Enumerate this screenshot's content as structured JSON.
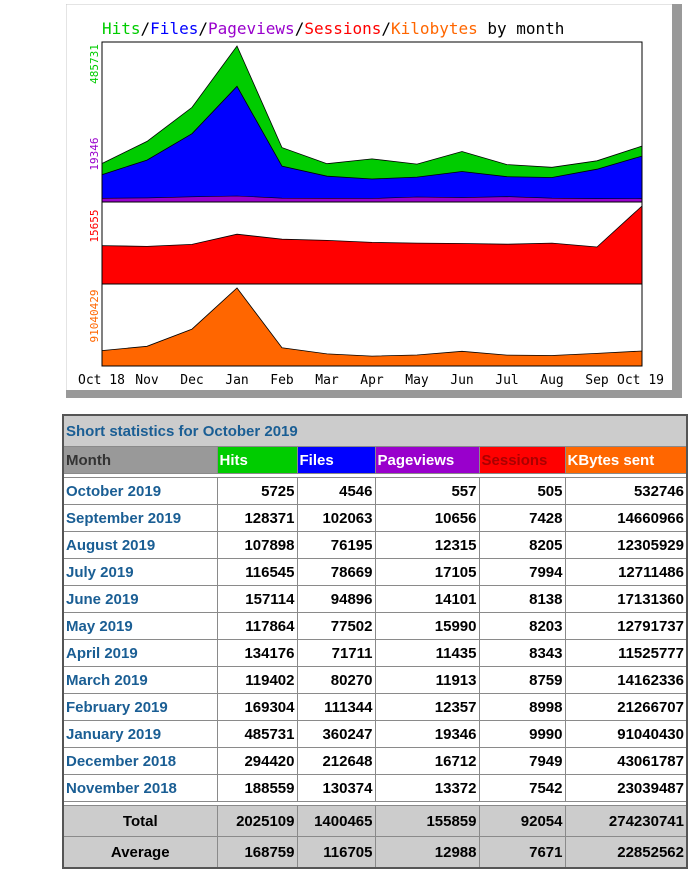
{
  "colors": {
    "hits": "#00cc00",
    "files": "#0000ff",
    "pageviews": "#9900cc",
    "sessions": "#ff0000",
    "kilobytes": "#ff6600",
    "label_blue": "#1a5e94"
  },
  "chart_data": {
    "type": "area",
    "title_parts": [
      {
        "text": "Hits",
        "key": "hits"
      },
      {
        "text": "/",
        "key": "sep"
      },
      {
        "text": "Files",
        "key": "files"
      },
      {
        "text": "/",
        "key": "sep"
      },
      {
        "text": "Pageviews",
        "key": "pageviews"
      },
      {
        "text": "/",
        "key": "sep"
      },
      {
        "text": "Sessions",
        "key": "sessions"
      },
      {
        "text": "/",
        "key": "sep"
      },
      {
        "text": "Kilobytes",
        "key": "kilobytes"
      },
      {
        "text": " by month",
        "key": "plain"
      }
    ],
    "x": [
      "Oct 18",
      "Nov",
      "Dec",
      "Jan",
      "Feb",
      "Mar",
      "Apr",
      "May",
      "Jun",
      "Jul",
      "Aug",
      "Sep",
      "Oct 19"
    ],
    "panels": [
      {
        "axis_label": "485731",
        "label_key": "hits",
        "series": [
          "hits",
          "files",
          "pageviews"
        ],
        "max": 485731
      },
      {
        "axis_label": "19346",
        "label_key": "pageviews",
        "series": [],
        "max": 19346
      },
      {
        "axis_label": "15655",
        "label_key": "sessions",
        "series": [
          "sessions"
        ],
        "max": 15655
      },
      {
        "axis_label": "91040429",
        "label_key": "kilobytes",
        "series": [
          "kilobytes"
        ],
        "max": 91040430
      }
    ],
    "series": [
      {
        "key": "hits",
        "values": [
          120000,
          188559,
          294420,
          485731,
          169304,
          119402,
          134176,
          117864,
          157114,
          116545,
          107898,
          128371,
          174000
        ]
      },
      {
        "key": "files",
        "values": [
          85000,
          130374,
          212648,
          360247,
          111344,
          80270,
          71711,
          77502,
          94896,
          78669,
          76195,
          102063,
          143000
        ]
      },
      {
        "key": "pageviews",
        "values": [
          12000,
          13372,
          16712,
          19346,
          12357,
          11913,
          11435,
          15990,
          14101,
          17105,
          12315,
          10656,
          11000
        ]
      },
      {
        "key": "sessions",
        "values": [
          7700,
          7542,
          7949,
          9990,
          8998,
          8759,
          8343,
          8203,
          8138,
          7994,
          8205,
          7428,
          15655
        ]
      },
      {
        "key": "kilobytes",
        "values": [
          18000000,
          23039487,
          43061787,
          91040430,
          21266707,
          14162336,
          11525777,
          12791737,
          17131360,
          12711486,
          12305929,
          14660966,
          17500000
        ]
      }
    ]
  },
  "table": {
    "title": "Short statistics for October 2019",
    "headers": [
      {
        "label": "Month",
        "key": "month"
      },
      {
        "label": "Hits",
        "key": "hits"
      },
      {
        "label": "Files",
        "key": "files"
      },
      {
        "label": "Pageviews",
        "key": "pageviews"
      },
      {
        "label": "Sessions",
        "key": "sessions"
      },
      {
        "label": "KBytes sent",
        "key": "kilobytes"
      }
    ],
    "rows": [
      [
        "October 2019",
        "5725",
        "4546",
        "557",
        "505",
        "532746"
      ],
      [
        "September 2019",
        "128371",
        "102063",
        "10656",
        "7428",
        "14660966"
      ],
      [
        "August 2019",
        "107898",
        "76195",
        "12315",
        "8205",
        "12305929"
      ],
      [
        "July 2019",
        "116545",
        "78669",
        "17105",
        "7994",
        "12711486"
      ],
      [
        "June 2019",
        "157114",
        "94896",
        "14101",
        "8138",
        "17131360"
      ],
      [
        "May 2019",
        "117864",
        "77502",
        "15990",
        "8203",
        "12791737"
      ],
      [
        "April 2019",
        "134176",
        "71711",
        "11435",
        "8343",
        "11525777"
      ],
      [
        "March 2019",
        "119402",
        "80270",
        "11913",
        "8759",
        "14162336"
      ],
      [
        "February 2019",
        "169304",
        "111344",
        "12357",
        "8998",
        "21266707"
      ],
      [
        "January 2019",
        "485731",
        "360247",
        "19346",
        "9990",
        "91040430"
      ],
      [
        "December 2018",
        "294420",
        "212648",
        "16712",
        "7949",
        "43061787"
      ],
      [
        "November 2018",
        "188559",
        "130374",
        "13372",
        "7542",
        "23039487"
      ]
    ],
    "total": [
      "Total",
      "2025109",
      "1400465",
      "155859",
      "92054",
      "274230741"
    ],
    "average": [
      "Average",
      "168759",
      "116705",
      "12988",
      "7671",
      "22852562"
    ]
  }
}
